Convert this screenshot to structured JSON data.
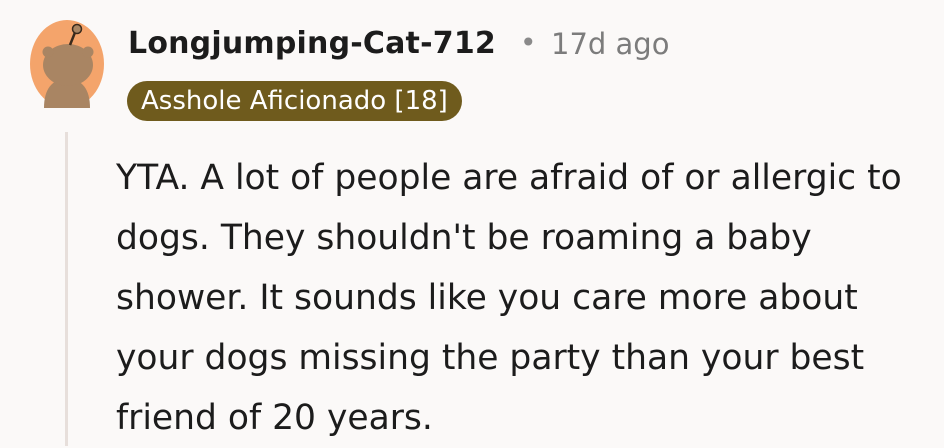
{
  "comment": {
    "author": "Longjumping-Cat-712",
    "separator": "•",
    "timestamp": "17d ago",
    "flair": "Asshole Aficionado [18]",
    "flair_color": "#6f5b1d",
    "avatar_icon": "snoo-avatar-icon",
    "avatar_color": "#f4a46b",
    "body": "YTA. A lot of people are afraid of or allergic to dogs. They shouldn't be roaming a baby shower. It sounds like you care more about your dogs missing the party than your best friend of 20 years."
  }
}
